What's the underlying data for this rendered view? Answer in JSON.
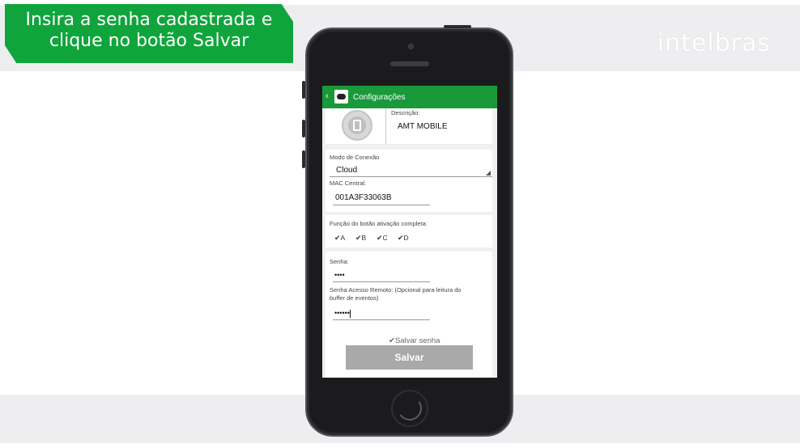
{
  "banner": {
    "line1": "Insira a senha cadastrada e",
    "line2": "clique no botão Salvar"
  },
  "brand": "intelbras",
  "app": {
    "title": "Configurações",
    "back_icon": "chevron-left-icon",
    "description_label": "Descrição:",
    "description_value": "AMT MOBILE",
    "connection_mode_label": "Modo de Conexão",
    "connection_mode_value": "Cloud",
    "mac_label": "MAC Central:",
    "mac_value": "001A3F33063B",
    "button_function_label": "Função do botão ativação completa:",
    "partitions": [
      "A",
      "B",
      "C",
      "D"
    ],
    "password_label": "Senha:",
    "password_value": "••••",
    "remote_password_label_1": "Senha Acesso Remoto: (Opcional para leitura do",
    "remote_password_label_2": "buffer de eventos)",
    "remote_password_value": "••••••",
    "save_password_label": "Salvar senha",
    "save_button": "Salvar",
    "colors": {
      "appbar": "#19993a",
      "banner": "#10a53c",
      "button": "#a9a9a9"
    }
  }
}
